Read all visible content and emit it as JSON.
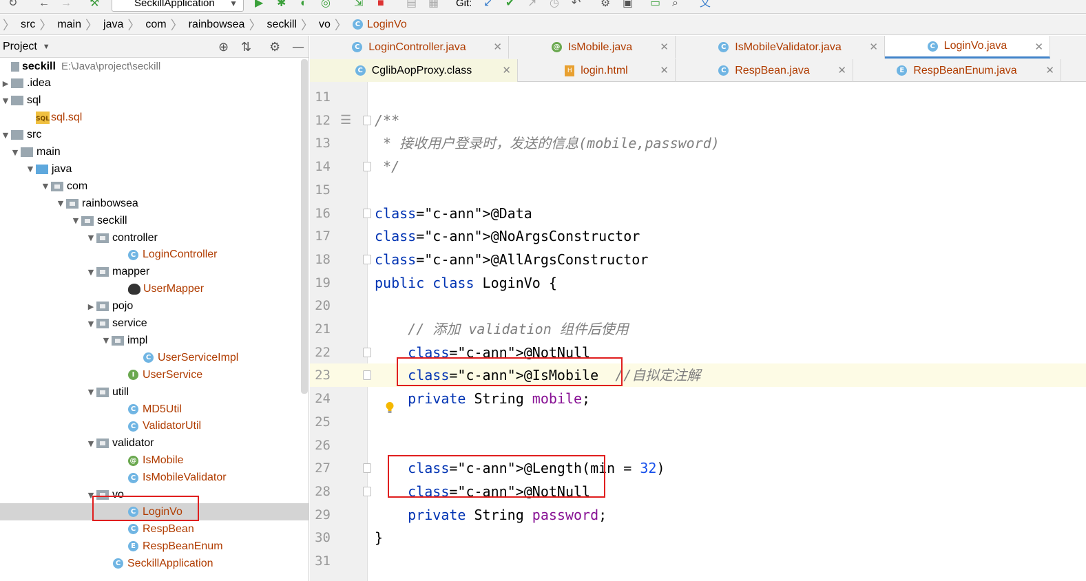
{
  "toolbar": {
    "run_config": "SeckillApplication",
    "git_label": "Git:"
  },
  "breadcrumb": [
    "src",
    "main",
    "java",
    "com",
    "rainbowsea",
    "seckill",
    "vo",
    "LoginVo"
  ],
  "project_panel": {
    "title": "Project",
    "root_name": "seckill",
    "root_path": "E:\\Java\\project\\seckill",
    "tree": [
      {
        "label": "seckill",
        "kind": "root"
      },
      {
        "label": ".idea",
        "kind": "folder"
      },
      {
        "label": "sql",
        "kind": "folder"
      },
      {
        "label": "sql.sql",
        "kind": "sql"
      },
      {
        "label": "src",
        "kind": "folder"
      },
      {
        "label": "main",
        "kind": "folder"
      },
      {
        "label": "java",
        "kind": "folder"
      },
      {
        "label": "com",
        "kind": "package"
      },
      {
        "label": "rainbowsea",
        "kind": "package"
      },
      {
        "label": "seckill",
        "kind": "package"
      },
      {
        "label": "controller",
        "kind": "package"
      },
      {
        "label": "LoginController",
        "kind": "class"
      },
      {
        "label": "mapper",
        "kind": "package"
      },
      {
        "label": "UserMapper",
        "kind": "mapper"
      },
      {
        "label": "pojo",
        "kind": "package"
      },
      {
        "label": "service",
        "kind": "package"
      },
      {
        "label": "impl",
        "kind": "package"
      },
      {
        "label": "UserServiceImpl",
        "kind": "class"
      },
      {
        "label": "UserService",
        "kind": "interface"
      },
      {
        "label": "utill",
        "kind": "package"
      },
      {
        "label": "MD5Util",
        "kind": "class"
      },
      {
        "label": "ValidatorUtil",
        "kind": "class"
      },
      {
        "label": "validator",
        "kind": "package"
      },
      {
        "label": "IsMobile",
        "kind": "annotation"
      },
      {
        "label": "IsMobileValidator",
        "kind": "class"
      },
      {
        "label": "vo",
        "kind": "package"
      },
      {
        "label": "LoginVo",
        "kind": "class",
        "selected": true
      },
      {
        "label": "RespBean",
        "kind": "class"
      },
      {
        "label": "RespBeanEnum",
        "kind": "enum"
      },
      {
        "label": "SeckillApplication",
        "kind": "class"
      }
    ]
  },
  "tabs_row1": [
    {
      "label": "LoginController.java",
      "icon": "C"
    },
    {
      "label": "IsMobile.java",
      "icon": "@"
    },
    {
      "label": "IsMobileValidator.java",
      "icon": "C"
    },
    {
      "label": "LoginVo.java",
      "icon": "C",
      "active": true
    }
  ],
  "tabs_row2": [
    {
      "label": "CglibAopProxy.class",
      "icon": "C"
    },
    {
      "label": "login.html",
      "icon": "H"
    },
    {
      "label": "RespBean.java",
      "icon": "C"
    },
    {
      "label": "RespBeanEnum.java",
      "icon": "E"
    }
  ],
  "editor": {
    "current_line": 23,
    "lines": [
      {
        "n": "11",
        "text": ""
      },
      {
        "n": "12",
        "text": "/**"
      },
      {
        "n": "13",
        "text": " * 接收用户登录时，发送的信息(mobile,password)"
      },
      {
        "n": "14",
        "text": " */"
      },
      {
        "n": "15",
        "text": ""
      },
      {
        "n": "16",
        "text": "@Data"
      },
      {
        "n": "17",
        "text": "@NoArgsConstructor"
      },
      {
        "n": "18",
        "text": "@AllArgsConstructor"
      },
      {
        "n": "19",
        "text": "public class LoginVo {"
      },
      {
        "n": "20",
        "text": ""
      },
      {
        "n": "21",
        "text": "    // 添加 validation 组件后使用"
      },
      {
        "n": "22",
        "text": "    @NotNull"
      },
      {
        "n": "23",
        "text": "    @IsMobile  //自拟定注解"
      },
      {
        "n": "24",
        "text": "    private String mobile;"
      },
      {
        "n": "25",
        "text": ""
      },
      {
        "n": "26",
        "text": ""
      },
      {
        "n": "27",
        "text": "    @Length(min = 32)"
      },
      {
        "n": "28",
        "text": "    @NotNull"
      },
      {
        "n": "29",
        "text": "    private String password;"
      },
      {
        "n": "30",
        "text": "}"
      },
      {
        "n": "31",
        "text": ""
      }
    ]
  },
  "colors": {
    "comment": "#808080",
    "annotation": "#9e880d",
    "keyword": "#0033b3",
    "field": "#871094",
    "number": "#1750eb",
    "highlight_box": "#e01e1e"
  }
}
